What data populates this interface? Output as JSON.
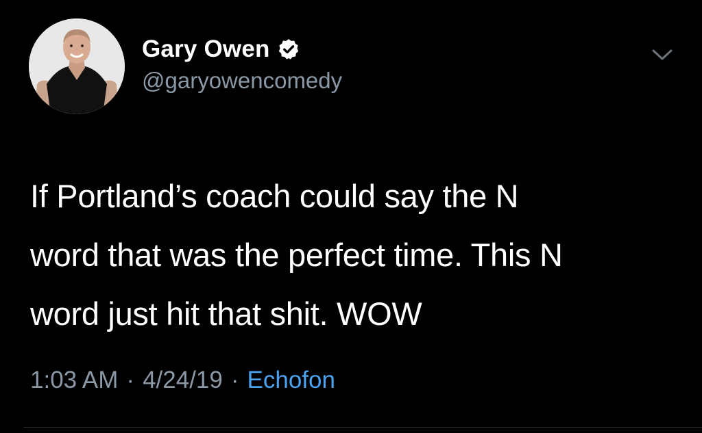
{
  "tweet": {
    "author": {
      "display_name": "Gary Owen",
      "handle": "@garyowencomedy",
      "verified_icon": "verified-badge-icon",
      "avatar": "profile-photo"
    },
    "menu_icon": "chevron-down-icon",
    "text_lines": [
      "If Portland’s coach could say the N",
      "word that was the perfect time. This N",
      "word just hit that shit. WOW"
    ],
    "time": "1:03 AM",
    "date": "4/24/19",
    "separator": "·",
    "source": "Echofon"
  },
  "colors": {
    "background": "#000000",
    "text": "#ffffff",
    "secondary_text": "#8b98a5",
    "link": "#4aa3f0",
    "divider": "#2f3336"
  }
}
